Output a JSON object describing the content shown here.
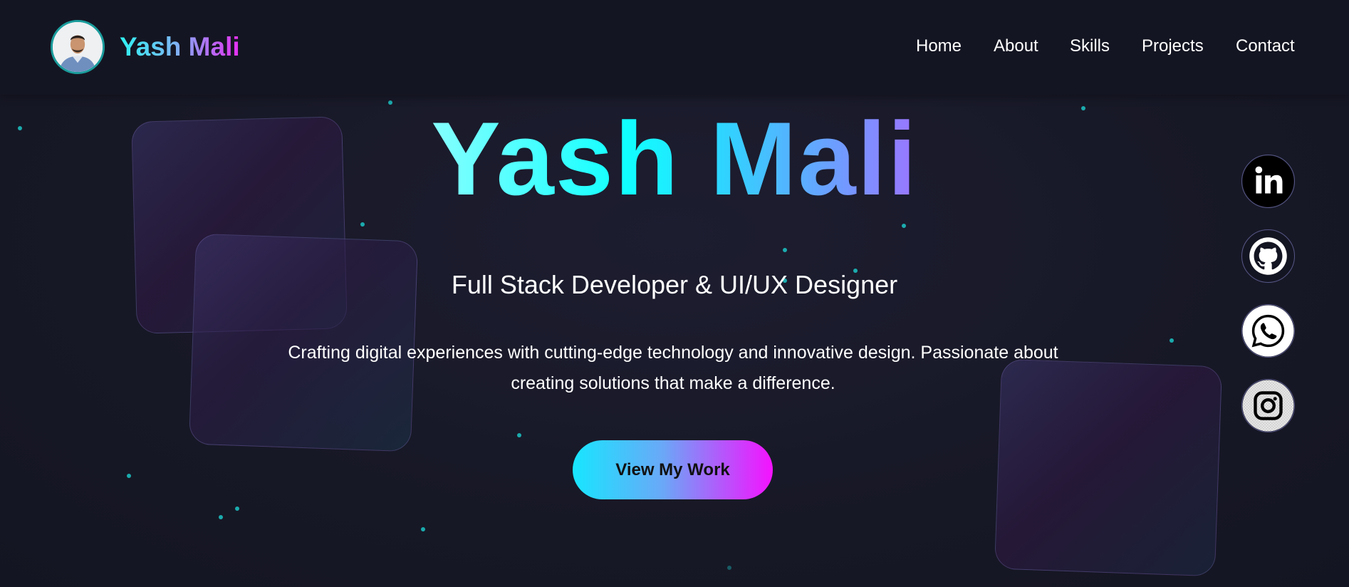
{
  "header": {
    "brand": "Yash Mali",
    "nav": [
      {
        "label": "Home"
      },
      {
        "label": "About"
      },
      {
        "label": "Skills"
      },
      {
        "label": "Projects"
      },
      {
        "label": "Contact"
      }
    ]
  },
  "hero": {
    "title": "Yash Mali",
    "subtitle": "Full Stack Developer & UI/UX Designer",
    "description": "Crafting digital experiences with cutting-edge technology and innovative design. Passionate about creating solutions that make a difference.",
    "cta_label": "View My Work"
  },
  "social": [
    {
      "icon": "linkedin-icon"
    },
    {
      "icon": "github-icon"
    },
    {
      "icon": "whatsapp-icon"
    },
    {
      "icon": "instagram-icon"
    }
  ],
  "colors": {
    "background": "#171826",
    "header": "#141522",
    "accent_cyan": "#10ffff",
    "accent_magenta": "#f512ff",
    "dot": "#1cc6c6"
  }
}
